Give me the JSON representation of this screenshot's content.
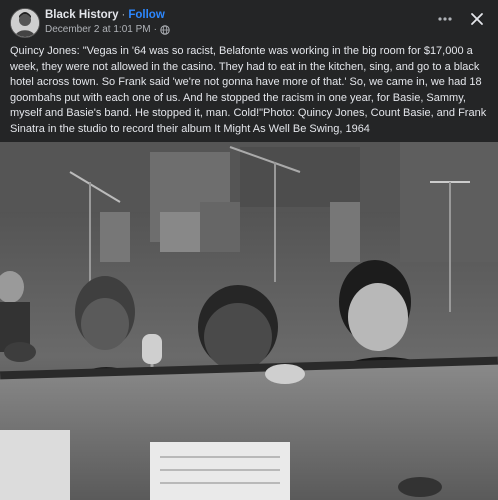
{
  "post": {
    "page_name": "Black History",
    "separator": "·",
    "follow_label": "Follow",
    "timestamp": "December 2 at 1:01 PM",
    "meta_separator": "·",
    "privacy_icon": "globe-icon",
    "more_icon": "more-options-icon",
    "close_icon": "close-icon",
    "caption": "Quincy Jones: \"Vegas in '64 was so racist, Belafonte was working in the big room for $17,000 a week, they were not allowed in the casino. They had to eat in the kitchen, sing, and go to a black hotel across town. So Frank said 'we're not gonna have more of that.' So, we came in, we had 18 goombahs put with each one of us. And he stopped the racism in one year, for Basie, Sammy, myself and Basie's band. He stopped it, man. Cold!\"Photo: Quincy Jones, Count Basie, and Frank Sinatra in the studio to record their album It Might As Well Be Swing, 1964"
  },
  "colors": {
    "background": "#242526",
    "text": "#e4e6eb",
    "secondary_text": "#b0b3b8",
    "link": "#2d88ff"
  }
}
